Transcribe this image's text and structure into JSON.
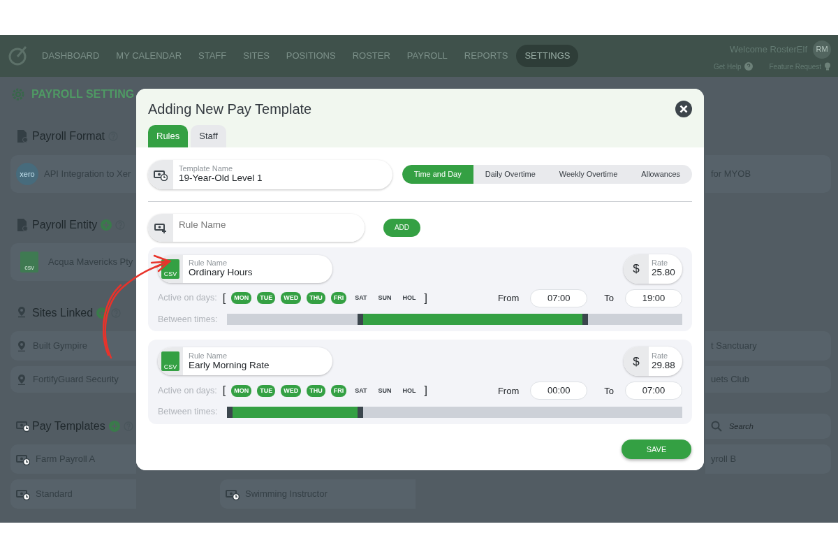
{
  "navbar": {
    "items": [
      {
        "label": "DASHBOARD",
        "selected": false
      },
      {
        "label": "MY CALENDAR",
        "selected": false
      },
      {
        "label": "STAFF",
        "selected": false
      },
      {
        "label": "SITES",
        "selected": false
      },
      {
        "label": "POSITIONS",
        "selected": false
      },
      {
        "label": "ROSTER",
        "selected": false
      },
      {
        "label": "PAYROLL",
        "selected": false
      },
      {
        "label": "REPORTS",
        "selected": false
      },
      {
        "label": "SETTINGS",
        "selected": true
      }
    ],
    "welcome": "Welcome RosterElf",
    "avatar": "RM",
    "links": [
      {
        "label": "Get Help",
        "kind": "help"
      },
      {
        "label": "Feature Request",
        "kind": "idea"
      }
    ]
  },
  "page": {
    "title": "PAYROLL SETTING",
    "format": {
      "title": "Payroll Format",
      "logo": "xero",
      "item": "API Integration to Xer",
      "right_item": "for MYOB"
    },
    "entity": {
      "title": "Payroll Entity",
      "icon_label": "csv",
      "item": "Acqua Mavericks Pty"
    },
    "sites": {
      "title": "Sites Linked",
      "items": [
        "Built Gympire",
        "FortifyGuard Security"
      ],
      "right_items": [
        "t Sanctuary",
        "uets Club"
      ]
    },
    "templates": {
      "title": "Pay Templates",
      "search": {
        "placeholder": "Search"
      },
      "items": [
        "Farm Payroll A",
        "Standard"
      ],
      "middle_items": [
        "Swimming Instructor"
      ],
      "right_items": [
        "yroll B"
      ]
    }
  },
  "modal": {
    "title": "Adding New Pay Template",
    "tabs": [
      {
        "label": "Rules",
        "selected": true
      },
      {
        "label": "Staff",
        "selected": false
      }
    ],
    "template_name": {
      "label": "Template Name",
      "value": "19-Year-Old Level 1"
    },
    "segments": [
      {
        "label": "Time and Day",
        "selected": true
      },
      {
        "label": "Daily Overtime",
        "selected": false
      },
      {
        "label": "Weekly Overtime",
        "selected": false
      },
      {
        "label": "Allowances",
        "selected": false
      }
    ],
    "new_rule": {
      "placeholder": "Rule Name",
      "button": "ADD"
    },
    "rules": [
      {
        "name_label": "Rule Name",
        "name": "Ordinary Hours",
        "icon_label": "CSV",
        "rate_label": "Rate",
        "currency": "$",
        "rate": "25.80",
        "days_label": "Active on days:",
        "open": "[",
        "close": "]",
        "days": [
          {
            "label": "MON",
            "selected": true
          },
          {
            "label": "TUE",
            "selected": true
          },
          {
            "label": "WED",
            "selected": true
          },
          {
            "label": "THU",
            "selected": true
          },
          {
            "label": "FRI",
            "selected": true
          },
          {
            "label": "SAT",
            "selected": false
          },
          {
            "label": "SUN",
            "selected": false
          },
          {
            "label": "HOL",
            "selected": false
          }
        ],
        "from_label": "From",
        "from": "07:00",
        "to_label": "To",
        "to": "19:00",
        "between_label": "Between times:",
        "range": {
          "start": {
            "level": 0.29
          },
          "end": {
            "level": 0.79
          }
        }
      },
      {
        "name_label": "Rule Name",
        "name": "Early Morning Rate",
        "icon_label": "CSV",
        "rate_label": "Rate",
        "currency": "$",
        "rate": "29.88",
        "days_label": "Active on days:",
        "open": "[",
        "close": "]",
        "days": [
          {
            "label": "MON",
            "selected": true
          },
          {
            "label": "TUE",
            "selected": true
          },
          {
            "label": "WED",
            "selected": true
          },
          {
            "label": "THU",
            "selected": true
          },
          {
            "label": "FRI",
            "selected": true
          },
          {
            "label": "SAT",
            "selected": false
          },
          {
            "label": "SUN",
            "selected": false
          },
          {
            "label": "HOL",
            "selected": false
          }
        ],
        "from_label": "From",
        "from": "00:00",
        "to_label": "To",
        "to": "07:00",
        "between_label": "Between times:",
        "range": {
          "start": {
            "level": 0
          },
          "end": {
            "level": 0.29
          }
        }
      }
    ],
    "save": "SAVE"
  },
  "annotation": {
    "kind": "arrow"
  }
}
